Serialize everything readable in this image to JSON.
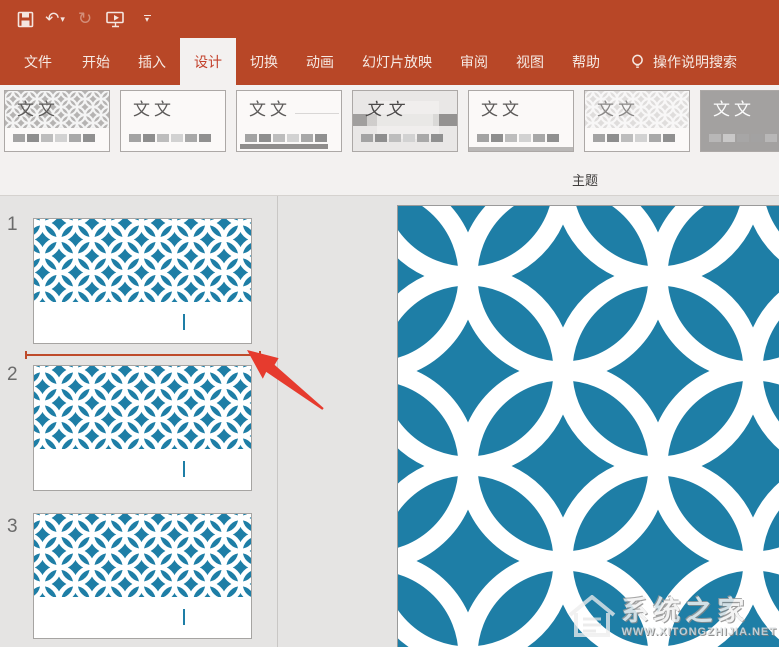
{
  "colors": {
    "accent_red": "#B84727",
    "active_tab_text": "#C3412B",
    "slide_blue": "#1E7EA6",
    "pattern_white": "#FFFFFF",
    "insert_line_red": "#BE4B2B",
    "arrow_red": "#E63B2E",
    "cursor_mark_teal": "#1E7EA6"
  },
  "titlebar": {
    "qat_icons": [
      "save-icon",
      "undo-icon",
      "redo-icon",
      "start-slideshow-icon",
      "customize-quick-access-icon"
    ]
  },
  "tabs": {
    "items": [
      {
        "label": "文件",
        "active": false
      },
      {
        "label": "开始",
        "active": false
      },
      {
        "label": "插入",
        "active": false
      },
      {
        "label": "设计",
        "active": true
      },
      {
        "label": "切换",
        "active": false
      },
      {
        "label": "动画",
        "active": false
      },
      {
        "label": "幻灯片放映",
        "active": false
      },
      {
        "label": "审阅",
        "active": false
      },
      {
        "label": "视图",
        "active": false
      },
      {
        "label": "帮助",
        "active": false
      }
    ],
    "assistant_search": {
      "icon": "lightbulb-icon",
      "label": "操作说明搜索"
    }
  },
  "ribbon": {
    "group_label": "主题",
    "themes": [
      {
        "sample_text": "文文",
        "style": "circle-pattern-gray"
      },
      {
        "sample_text": "文文",
        "style": "plain-white"
      },
      {
        "sample_text": "文文",
        "style": "bottom-dark-bar"
      },
      {
        "sample_text": "文文",
        "style": "gray-band"
      },
      {
        "sample_text": "文文",
        "style": "bottom-strip"
      },
      {
        "sample_text": "文文",
        "style": "circle-pattern-light"
      },
      {
        "sample_text": "文文",
        "style": "dark-gray"
      }
    ]
  },
  "slide_panel": {
    "slides": [
      {
        "number": "1"
      },
      {
        "number": "2"
      },
      {
        "number": "3"
      }
    ]
  },
  "annotations": {
    "insertion_line": "slide-reorder-indicator",
    "arrow": "red-annotation-arrow"
  },
  "watermark": {
    "site_name": "系统之家",
    "site_url": "WWW.XITONGZHIJIA.NET"
  }
}
